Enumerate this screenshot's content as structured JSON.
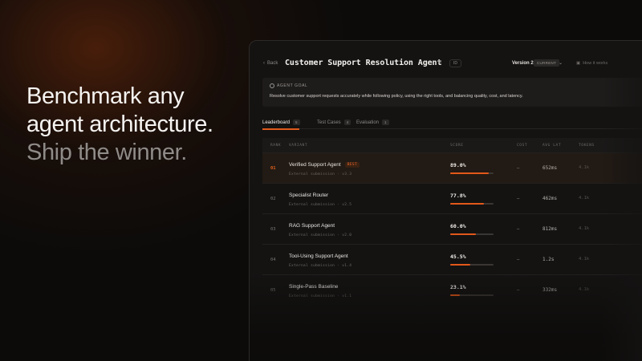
{
  "hero": {
    "line1": "Benchmark any",
    "line2": "agent architecture.",
    "line3": "Ship the winner."
  },
  "header": {
    "back_label": "Back",
    "title": "Customer Support Resolution Agent",
    "id_chip": "ID",
    "version_label": "Version 2",
    "version_badge": "CURRENT",
    "how_label": "How it works"
  },
  "goal": {
    "heading": "AGENT GOAL",
    "text": "Resolve customer support requests accurately while following policy, using the right tools, and balancing quality, cost, and latency."
  },
  "tabs": [
    {
      "label": "Leaderboard",
      "count": "5"
    },
    {
      "label": "Test Cases",
      "count": "4"
    },
    {
      "label": "Evaluation",
      "count": "1"
    }
  ],
  "table": {
    "columns": [
      "RANK",
      "VARIANT",
      "SCORE",
      "COST",
      "AVG LAT",
      "TOKENS"
    ],
    "best_badge": "BEST",
    "rows": [
      {
        "rank": "01",
        "name": "Verified Support Agent",
        "sub": "External submission · v3.3",
        "score": "89.0%",
        "score_value": 0.89,
        "cost": "–",
        "latency": "652ms",
        "extra": "4.1k",
        "best": true
      },
      {
        "rank": "02",
        "name": "Specialist Router",
        "sub": "External submission · v2.5",
        "score": "77.8%",
        "score_value": 0.778,
        "cost": "–",
        "latency": "462ms",
        "extra": "4.1k",
        "best": false
      },
      {
        "rank": "03",
        "name": "RAG Support Agent",
        "sub": "External submission · v2.0",
        "score": "60.0%",
        "score_value": 0.6,
        "cost": "–",
        "latency": "812ms",
        "extra": "4.1k",
        "best": false
      },
      {
        "rank": "04",
        "name": "Tool-Using Support Agent",
        "sub": "External submission · v1.4",
        "score": "45.5%",
        "score_value": 0.455,
        "cost": "–",
        "latency": "1.2s",
        "extra": "4.1k",
        "best": false
      },
      {
        "rank": "05",
        "name": "Single-Pass Baseline",
        "sub": "External submission · v1.1",
        "score": "23.1%",
        "score_value": 0.231,
        "cost": "–",
        "latency": "332ms",
        "extra": "4.1k",
        "best": false
      }
    ]
  },
  "colors": {
    "accent": "#e3581a",
    "background": "#0c0b0a",
    "panel": "#141312"
  }
}
